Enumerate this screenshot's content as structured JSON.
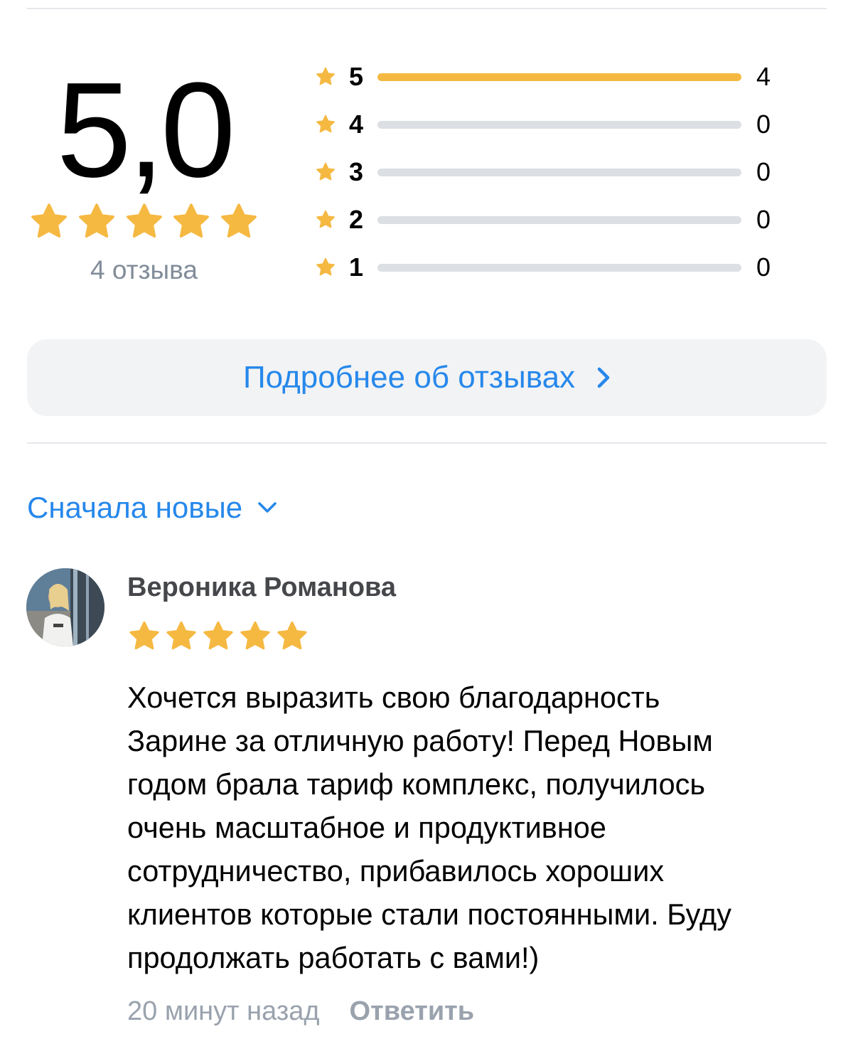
{
  "summary": {
    "rating": "5,0",
    "stars_filled": 5,
    "reviews_count_label": "4 отзыва",
    "distribution": [
      {
        "level": "5",
        "count": "4",
        "fraction": 1.0
      },
      {
        "level": "4",
        "count": "0",
        "fraction": 0.0
      },
      {
        "level": "3",
        "count": "0",
        "fraction": 0.0
      },
      {
        "level": "2",
        "count": "0",
        "fraction": 0.0
      },
      {
        "level": "1",
        "count": "0",
        "fraction": 0.0
      }
    ]
  },
  "more_button": {
    "label": "Подробнее об отзывах",
    "icon": "chevron-right-icon"
  },
  "sort": {
    "label": "Сначала новые",
    "icon": "chevron-down-icon"
  },
  "reviews": [
    {
      "author": "Вероника Романова",
      "stars": 5,
      "text": "Хочется выразить свою благодарность\nЗарине за отличную работу! Перед Новым\nгодом брала тариф комплекс, получилось\nочень масштабное и продуктивное\nсотрудничество, прибавилось хороших\nклиентов которые стали постоянными. Буду\nпродолжать работать с вами!)",
      "time": "20 минут назад",
      "reply_label": "Ответить"
    }
  ],
  "colors": {
    "star": "#f5b942",
    "accent": "#2688eb",
    "bar_empty": "#dcdfe3",
    "muted": "#818c99"
  }
}
